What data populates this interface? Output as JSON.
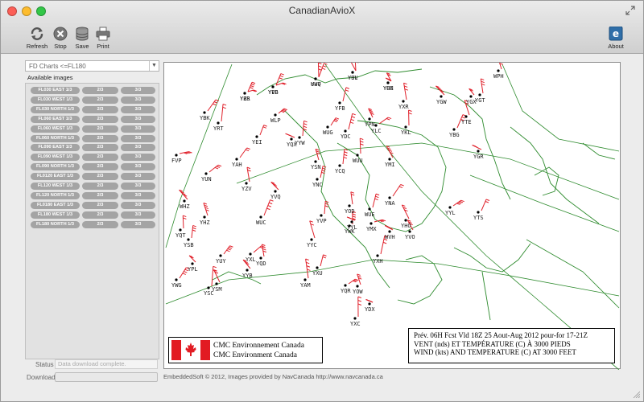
{
  "window": {
    "title": "CanadianAvioX"
  },
  "toolbar": {
    "refresh_label": "Refresh",
    "stop_label": "Stop",
    "save_label": "Save",
    "print_label": "Print",
    "about_label": "About"
  },
  "sidebar": {
    "dropdown_value": "FD Charts  <=FL180",
    "available_label": "Available images",
    "images": [
      {
        "label": "FL030 EAST 1/3",
        "p2": "2/3",
        "p3": "3/3"
      },
      {
        "label": "FL030 WEST 1/3",
        "p2": "2/3",
        "p3": "3/3"
      },
      {
        "label": "FL030 NORTH 1/3",
        "p2": "2/3",
        "p3": "3/3"
      },
      {
        "label": "FL060 EAST 1/3",
        "p2": "2/3",
        "p3": "3/3"
      },
      {
        "label": "FL060 WEST 1/3",
        "p2": "2/3",
        "p3": "3/3"
      },
      {
        "label": "FL060 NORTH 1/3",
        "p2": "2/3",
        "p3": "3/3"
      },
      {
        "label": "FL090 EAST 1/3",
        "p2": "2/3",
        "p3": "3/3"
      },
      {
        "label": "FL090 WEST 1/3",
        "p2": "2/3",
        "p3": "3/3"
      },
      {
        "label": "FL090 NORTH 1/3",
        "p2": "2/3",
        "p3": "3/3"
      },
      {
        "label": "FL0120 EAST 1/3",
        "p2": "2/3",
        "p3": "3/3"
      },
      {
        "label": "FL120 WEST 1/3",
        "p2": "2/3",
        "p3": "3/3"
      },
      {
        "label": "FL120 NORTH 1/3",
        "p2": "2/3",
        "p3": "3/3"
      },
      {
        "label": "FL0180 EAST 1/3",
        "p2": "2/3",
        "p3": "3/3"
      },
      {
        "label": "FL180 WEST 1/3",
        "p2": "2/3",
        "p3": "3/3"
      },
      {
        "label": "FL180 NORTH 1/3",
        "p2": "2/3",
        "p3": "3/3"
      }
    ]
  },
  "status": {
    "label": "Status",
    "value": "Data download complete."
  },
  "download": {
    "label": "Download",
    "progress": 0
  },
  "footer": {
    "credit": "EmbeddedSoft © 2012, Images provided by NavCanada http://www.navcanada.ca"
  },
  "map": {
    "caption_lines": [
      "Prév. 06H Fcst Vld 18Z 25 Aout-Aug 2012 pour-for 17-21Z",
      "VENT (nds) ET TEMPÉRATURE (C) À 3000 PIEDS",
      "WIND (kts) AND TEMPERATURE (C) AT 3000 FEET"
    ],
    "agency_lines": [
      "CMC Environnement Canada",
      "CMC Environment Canada"
    ],
    "stations": [
      "YZS",
      "YVB",
      "UHQ",
      "YSV",
      "YHO",
      "WPH",
      "YRT",
      "YBK",
      "WLP",
      "YFB",
      "YXR",
      "YGW",
      "YGX",
      "YGT",
      "YDC",
      "YLC",
      "WUG",
      "YYW",
      "YTE",
      "YQX",
      "YPN",
      "YKL",
      "YBG",
      "FVP",
      "YEI",
      "WUU",
      "YMI",
      "YGR",
      "YSN",
      "YCQ",
      "YAH",
      "YUN",
      "YNC",
      "YZV",
      "YVQ",
      "WHZ",
      "YOD",
      "WUE",
      "YYL",
      "YNA",
      "YVP",
      "YHZ",
      "YYL",
      "YHO",
      "YWK",
      "YTS",
      "YMX",
      "WUC",
      "YQT",
      "YVO",
      "WVH",
      "YYC",
      "YSB",
      "YUY",
      "YXL",
      "YXH",
      "YQD",
      "YPL",
      "YYB",
      "YAM",
      "YXU",
      "YQR",
      "YWG",
      "YSC",
      "YOW",
      "YDX",
      "YSM",
      "YXC",
      "YBR",
      "YEG",
      "YVV",
      "YUL",
      "YGK"
    ],
    "colors": {
      "coast": "#2e8b2e",
      "wind_barb": "#e0202a",
      "grid": "#2e8b2e"
    }
  }
}
